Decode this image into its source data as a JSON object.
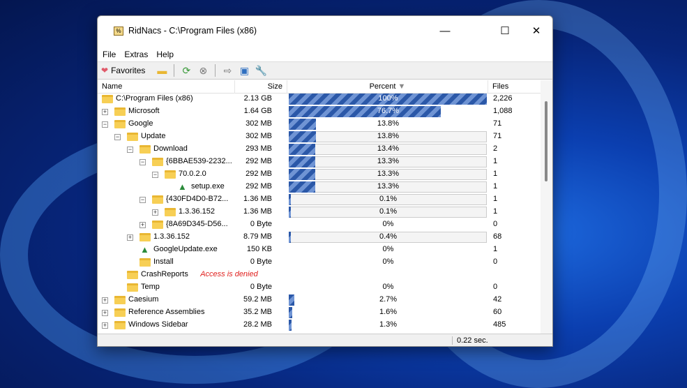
{
  "window": {
    "title": "RidNacs - C:\\Program Files (x86)",
    "minimize": "—",
    "maximize": "☐",
    "close": "✕"
  },
  "menu": [
    "File",
    "Extras",
    "Help"
  ],
  "toolbar": {
    "favorites": "Favorites"
  },
  "columns": {
    "name": "Name",
    "size": "Size",
    "percent": "Percent",
    "files": "Files"
  },
  "rows": [
    {
      "name": "C:\\Program Files (x86)",
      "depth": 0,
      "exp": "",
      "size": "2.13 GB",
      "percent": "100%",
      "fill": 1.0,
      "track": false,
      "files": "2,226"
    },
    {
      "name": "Microsoft",
      "depth": 1,
      "exp": "+",
      "size": "1.64 GB",
      "percent": "76.7%",
      "fill": 0.767,
      "track": false,
      "files": "1,088"
    },
    {
      "name": "Google",
      "depth": 1,
      "exp": "−",
      "size": "302 MB",
      "percent": "13.8%",
      "fill": 0.138,
      "track": false,
      "files": "71"
    },
    {
      "name": "Update",
      "depth": 2,
      "exp": "−",
      "size": "302 MB",
      "percent": "13.8%",
      "fill": 0.138,
      "track": true,
      "files": "71"
    },
    {
      "name": "Download",
      "depth": 3,
      "exp": "−",
      "size": "293 MB",
      "percent": "13.4%",
      "fill": 0.134,
      "track": true,
      "files": "2"
    },
    {
      "name": "{6BBAE539-2232...",
      "depth": 4,
      "exp": "−",
      "size": "292 MB",
      "percent": "13.3%",
      "fill": 0.133,
      "track": true,
      "files": "1"
    },
    {
      "name": "70.0.2.0",
      "depth": 5,
      "exp": "−",
      "size": "292 MB",
      "percent": "13.3%",
      "fill": 0.133,
      "track": true,
      "files": "1"
    },
    {
      "name": "setup.exe",
      "depth": 6,
      "exp": "",
      "file": true,
      "size": "292 MB",
      "percent": "13.3%",
      "fill": 0.133,
      "track": true,
      "files": "1"
    },
    {
      "name": "{430FD4D0-B72...",
      "depth": 4,
      "exp": "−",
      "size": "1.36 MB",
      "percent": "0.1%",
      "fill": 0.001,
      "track": true,
      "files": "1"
    },
    {
      "name": "1.3.36.152",
      "depth": 5,
      "exp": "+",
      "size": "1.36 MB",
      "percent": "0.1%",
      "fill": 0.001,
      "track": true,
      "files": "1"
    },
    {
      "name": "{8A69D345-D56...",
      "depth": 4,
      "exp": "+",
      "size": "0 Byte",
      "percent": "0%",
      "fill": 0,
      "track": false,
      "files": "0"
    },
    {
      "name": "1.3.36.152",
      "depth": 3,
      "exp": "+",
      "size": "8.79 MB",
      "percent": "0.4%",
      "fill": 0.004,
      "track": true,
      "files": "68"
    },
    {
      "name": "GoogleUpdate.exe",
      "depth": 3,
      "exp": "",
      "file": true,
      "size": "150 KB",
      "percent": "0%",
      "fill": 0,
      "track": false,
      "files": "1"
    },
    {
      "name": "Install",
      "depth": 3,
      "exp": "",
      "size": "0 Byte",
      "percent": "0%",
      "fill": 0,
      "track": false,
      "files": "0"
    },
    {
      "name": "CrashReports",
      "depth": 2,
      "exp": "",
      "size": "",
      "error": "Access is denied",
      "percent": "",
      "fill": 0,
      "track": false,
      "files": ""
    },
    {
      "name": "Temp",
      "depth": 2,
      "exp": "",
      "size": "0 Byte",
      "percent": "0%",
      "fill": 0,
      "track": false,
      "files": "0"
    },
    {
      "name": "Caesium",
      "depth": 1,
      "exp": "+",
      "size": "59.2 MB",
      "percent": "2.7%",
      "fill": 0.027,
      "track": false,
      "files": "42"
    },
    {
      "name": "Reference Assemblies",
      "depth": 1,
      "exp": "+",
      "size": "35.2 MB",
      "percent": "1.6%",
      "fill": 0.016,
      "track": false,
      "files": "60"
    },
    {
      "name": "Windows Sidebar",
      "depth": 1,
      "exp": "+",
      "size": "28.2 MB",
      "percent": "1.3%",
      "fill": 0.013,
      "track": false,
      "files": "485"
    }
  ],
  "status": {
    "time": "0.22 sec."
  }
}
